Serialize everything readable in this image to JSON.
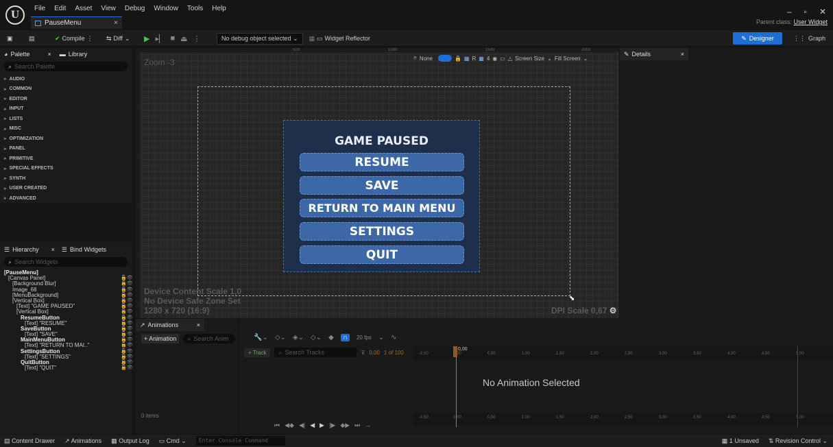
{
  "menu_bar": [
    "File",
    "Edit",
    "Asset",
    "View",
    "Debug",
    "Window",
    "Tools",
    "Help"
  ],
  "logo": "U",
  "document_tab": "PauseMenu",
  "parent_class": {
    "label": "Parent class:",
    "value": "User Widget"
  },
  "toolbar": {
    "compile": "Compile",
    "diff": "Diff",
    "debug_object": "No debug object selected",
    "widget_reflector": "Widget Reflector",
    "designer": "Designer",
    "graph": "Graph"
  },
  "palette": {
    "tab": "Palette",
    "library_tab": "Library",
    "search_placeholder": "Search Palette",
    "categories": [
      "AUDIO",
      "COMMON",
      "EDITOR",
      "INPUT",
      "LISTS",
      "MISC",
      "OPTIMIZATION",
      "PANEL",
      "PRIMITIVE",
      "SPECIAL EFFECTS",
      "SYNTH",
      "USER CREATED",
      "ADVANCED"
    ]
  },
  "hierarchy": {
    "tab": "Hierarchy",
    "bind_tab": "Bind Widgets",
    "search_placeholder": "Search Widgets",
    "items": [
      {
        "label": "[PauseMenu]",
        "indent": 0,
        "bold": true
      },
      {
        "label": "[Canvas Panel]",
        "indent": 1
      },
      {
        "label": "[Background Blur]",
        "indent": 2
      },
      {
        "label": "Image_68",
        "indent": 2
      },
      {
        "label": "[MenuBackground]",
        "indent": 2
      },
      {
        "label": "[Vertical Box]",
        "indent": 2
      },
      {
        "label": "[Text] \"GAME PAUSED\"",
        "indent": 3
      },
      {
        "label": "[Vertical Box]",
        "indent": 3
      },
      {
        "label": "ResumeButton",
        "indent": 4,
        "bold": true
      },
      {
        "label": "[Text] \"RESUME\"",
        "indent": 5
      },
      {
        "label": "SaveButton",
        "indent": 4,
        "bold": true
      },
      {
        "label": "[Text] \"SAVE\"",
        "indent": 5
      },
      {
        "label": "MainMenuButton",
        "indent": 4,
        "bold": true
      },
      {
        "label": "[Text] \"RETURN TO MAI..\"",
        "indent": 5
      },
      {
        "label": "SettingsButton",
        "indent": 4,
        "bold": true
      },
      {
        "label": "[Text] \"SETTINGS\"",
        "indent": 5
      },
      {
        "label": "QuitButton",
        "indent": 4,
        "bold": true
      },
      {
        "label": "[Text] \"QUIT\"",
        "indent": 5
      }
    ]
  },
  "viewport": {
    "zoom": "Zoom -3",
    "content_scale": "Device Content Scale 1,0",
    "safe_zone": "No Device Safe Zone Set",
    "resolution": "1280 x 720 (16:9)",
    "dpi": "DPI Scale 0,67",
    "ruler_marks": [
      "500",
      "1000",
      "1500",
      "2000"
    ],
    "toolbar": {
      "none": "None",
      "r": "R",
      "grid": "4",
      "screen_size": "Screen Size",
      "fill": "Fill Screen"
    }
  },
  "pause_menu": {
    "title": "GAME PAUSED",
    "buttons": [
      "RESUME",
      "SAVE",
      "RETURN TO MAIN MENU",
      "SETTINGS",
      "QUIT"
    ]
  },
  "details": {
    "tab": "Details"
  },
  "animations": {
    "tab": "Animations",
    "add": "+ Animation",
    "search_placeholder": "Search Anim",
    "track": "+ Track",
    "track_search": "Search Tracks",
    "fps": "20 fps",
    "time": "0,00",
    "frames": "1 of 100",
    "items_count": "0 items",
    "empty_message": "No Animation Selected",
    "time_label": "0,00",
    "ticks": [
      "-0,50",
      "0,00",
      "0,50",
      "1,00",
      "1,50",
      "2,00",
      "2,50",
      "3,00",
      "3,50",
      "4,00",
      "4,50",
      "5,00"
    ]
  },
  "status_bar": {
    "content_drawer": "Content Drawer",
    "animations": "Animations",
    "output_log": "Output Log",
    "cmd": "Cmd",
    "console_placeholder": "Enter Console Command",
    "unsaved": "1 Unsaved",
    "revision": "Revision Control"
  },
  "colors": {
    "accent": "#1d6ed6",
    "menu_bg": "#1d2f4a",
    "button_bg": "#3d68a8",
    "playhead": "#3bb14a"
  }
}
